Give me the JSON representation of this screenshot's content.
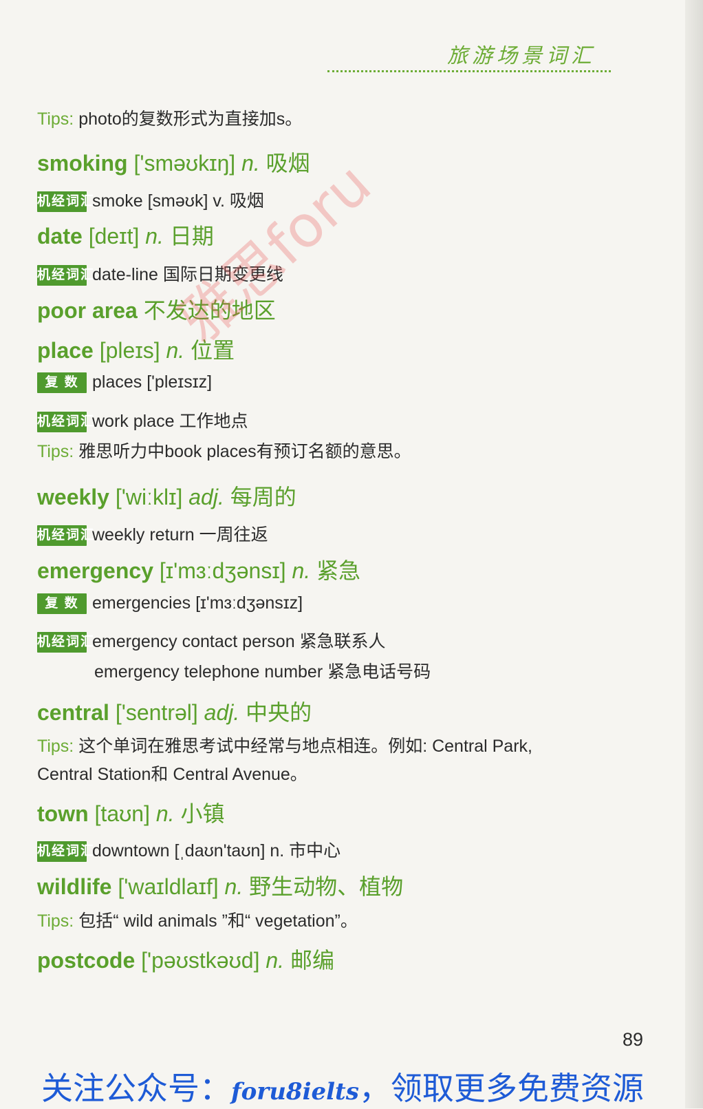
{
  "header": {
    "section_title": "旅游场景词汇"
  },
  "watermark": "雅思foru",
  "entries": [
    {
      "kind": "tips",
      "label": "Tips:",
      "text": " photo的复数形式为直接加s。"
    },
    {
      "kind": "headword",
      "word": "smoking",
      "pron": " ['sməʊkɪŋ]",
      "pos": " n.",
      "meaning": " 吸烟"
    },
    {
      "kind": "related",
      "badge": "机经词汇",
      "text": "smoke [sməʊk] v. 吸烟"
    },
    {
      "kind": "headword",
      "word": "date",
      "pron": " [deɪt]",
      "pos": " n.",
      "meaning": " 日期"
    },
    {
      "kind": "related",
      "badge": "机经词汇",
      "text": "date-line 国际日期变更线"
    },
    {
      "kind": "headword",
      "word": "poor area",
      "pron": "",
      "pos": "",
      "meaning": " 不发达的地区"
    },
    {
      "kind": "headword",
      "word": "place",
      "pron": " [pleɪs]",
      "pos": " n.",
      "meaning": " 位置"
    },
    {
      "kind": "related",
      "badge": "复 数",
      "text": "places ['pleɪsɪz]"
    },
    {
      "kind": "related",
      "badge": "机经词汇",
      "text": "work place 工作地点"
    },
    {
      "kind": "tips",
      "label": "Tips:",
      "text": " 雅思听力中book places有预订名额的意思。"
    },
    {
      "kind": "headword",
      "word": "weekly",
      "pron": " ['wiːklɪ]",
      "pos": " adj.",
      "meaning": " 每周的"
    },
    {
      "kind": "related",
      "badge": "机经词汇",
      "text": "weekly return 一周往返"
    },
    {
      "kind": "headword",
      "word": "emergency",
      "pron": " [ɪ'mɜːdʒənsɪ]",
      "pos": " n.",
      "meaning": " 紧急"
    },
    {
      "kind": "related",
      "badge": "复 数",
      "text": "emergencies [ɪ'mɜːdʒənsɪz]"
    },
    {
      "kind": "related",
      "badge": "机经词汇",
      "text": "emergency contact person 紧急联系人"
    },
    {
      "kind": "continuation",
      "text": "emergency telephone number 紧急电话号码"
    },
    {
      "kind": "headword",
      "word": "central",
      "pron": " ['sentrəl]",
      "pos": " adj.",
      "meaning": " 中央的"
    },
    {
      "kind": "tips",
      "label": "Tips:",
      "text": " 这个单词在雅思考试中经常与地点相连。例如: Central Park,"
    },
    {
      "kind": "plain",
      "text": "Central Station和 Central Avenue。"
    },
    {
      "kind": "headword",
      "word": "town",
      "pron": " [taʊn]",
      "pos": " n.",
      "meaning": " 小镇"
    },
    {
      "kind": "related",
      "badge": "机经词汇",
      "text": "downtown [ˌdaʊn'taʊn] n. 市中心"
    },
    {
      "kind": "headword",
      "word": "wildlife",
      "pron": " ['waɪldlaɪf]",
      "pos": " n.",
      "meaning": " 野生动物、植物"
    },
    {
      "kind": "tips",
      "label": "Tips:",
      "text": " 包括“ wild animals ”和“ vegetation”。"
    },
    {
      "kind": "headword",
      "word": "postcode",
      "pron": " ['pəʊstkəʊd]",
      "pos": " n.",
      "meaning": " 邮编"
    }
  ],
  "page_number": "89",
  "promo": {
    "before": "关注公众号：",
    "handle": "foru8ielts",
    "after": "，领取更多免费资源"
  }
}
